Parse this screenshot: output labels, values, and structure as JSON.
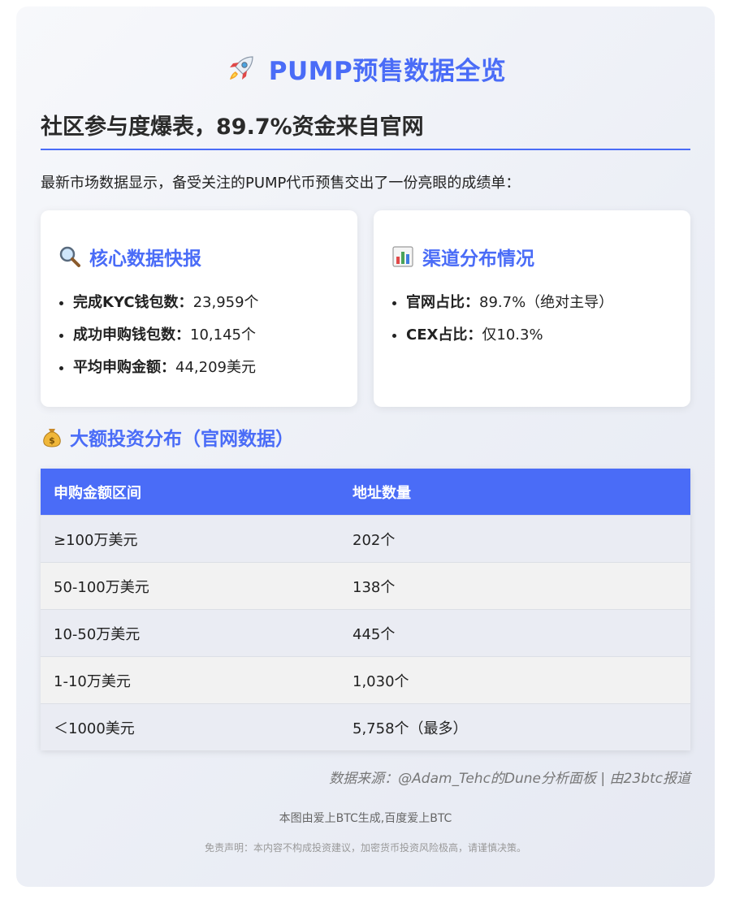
{
  "header": {
    "title": "PUMP预售数据全览",
    "subtitle": "社区参与度爆表，89.7%资金来自官网",
    "intro": "最新市场数据显示，备受关注的PUMP代币预售交出了一份亮眼的成绩单："
  },
  "core": {
    "title": "核心数据快报",
    "icon": "magnifier-icon",
    "items": [
      {
        "label": "完成KYC钱包数：",
        "value": "23,959个"
      },
      {
        "label": "成功申购钱包数：",
        "value": "10,145个"
      },
      {
        "label": "平均申购金额：",
        "value": "44,209美元"
      }
    ]
  },
  "channels": {
    "title": "渠道分布情况",
    "icon": "bar-chart-icon",
    "items": [
      {
        "label": "官网占比：",
        "value": "89.7%（绝对主导）"
      },
      {
        "label": "CEX占比：",
        "value": "仅10.3%"
      }
    ]
  },
  "distribution": {
    "title": "大额投资分布（官网数据）",
    "icon": "money-bag-icon",
    "headers": [
      "申购金额区间",
      "地址数量"
    ],
    "rows": [
      [
        "≥100万美元",
        "202个"
      ],
      [
        "50-100万美元",
        "138个"
      ],
      [
        "10-50万美元",
        "445个"
      ],
      [
        "1-10万美元",
        "1,030个"
      ],
      [
        "＜1000美元",
        "5,758个（最多）"
      ]
    ]
  },
  "footer": {
    "source": "数据来源：@Adam_Tehc的Dune分析面板 | 由23btc报道",
    "credit": "本图由爱上BTC生成,百度爱上BTC",
    "disclaimer": "免责声明：本内容不构成投资建议，加密货币投资风险极高，请谨慎决策。"
  },
  "colors": {
    "accent": "#4a6cf7",
    "table_header": "#4a6cf7",
    "row_odd": "#eaecf3",
    "row_even": "#f2f2f2"
  }
}
